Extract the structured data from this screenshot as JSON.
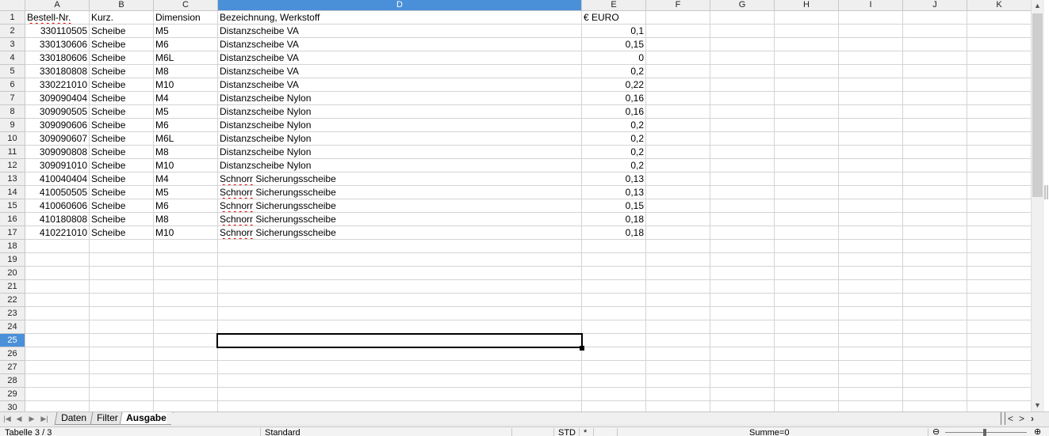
{
  "columns": [
    "A",
    "B",
    "C",
    "D",
    "E",
    "F",
    "G",
    "H",
    "I",
    "J",
    "K"
  ],
  "selected_column": "D",
  "selected_row": "25",
  "row_numbers": [
    "1",
    "2",
    "3",
    "4",
    "5",
    "6",
    "7",
    "8",
    "9",
    "10",
    "11",
    "12",
    "13",
    "14",
    "15",
    "16",
    "17",
    "18",
    "19",
    "20",
    "21",
    "22",
    "23",
    "24",
    "25",
    "26",
    "27",
    "28",
    "29",
    "30"
  ],
  "table": {
    "headers": [
      "Bestell-Nr.",
      "Kurz.",
      "Dimension",
      "Bezeichnung, Werkstoff",
      "€ EURO"
    ],
    "rows": [
      [
        "330110505",
        "Scheibe",
        "M5",
        "Distanzscheibe VA",
        "0,1"
      ],
      [
        "330130606",
        "Scheibe",
        "M6",
        "Distanzscheibe VA",
        "0,15"
      ],
      [
        "330180606",
        "Scheibe",
        "M6L",
        "Distanzscheibe VA",
        "0"
      ],
      [
        "330180808",
        "Scheibe",
        "M8",
        "Distanzscheibe VA",
        "0,2"
      ],
      [
        "330221010",
        "Scheibe",
        "M10",
        "Distanzscheibe VA",
        "0,22"
      ],
      [
        "309090404",
        "Scheibe",
        "M4",
        "Distanzscheibe Nylon",
        "0,16"
      ],
      [
        "309090505",
        "Scheibe",
        "M5",
        "Distanzscheibe Nylon",
        "0,16"
      ],
      [
        "309090606",
        "Scheibe",
        "M6",
        "Distanzscheibe Nylon",
        "0,2"
      ],
      [
        "309090607",
        "Scheibe",
        "M6L",
        "Distanzscheibe Nylon",
        "0,2"
      ],
      [
        "309090808",
        "Scheibe",
        "M8",
        "Distanzscheibe Nylon",
        "0,2"
      ],
      [
        "309091010",
        "Scheibe",
        "M10",
        "Distanzscheibe Nylon",
        "0,2"
      ],
      [
        "410040404",
        "Scheibe",
        "M4",
        "Schnorr Sicherungsscheibe",
        "0,13"
      ],
      [
        "410050505",
        "Scheibe",
        "M5",
        "Schnorr Sicherungsscheibe",
        "0,13"
      ],
      [
        "410060606",
        "Scheibe",
        "M6",
        "Schnorr Sicherungsscheibe",
        "0,15"
      ],
      [
        "410180808",
        "Scheibe",
        "M8",
        "Schnorr Sicherungsscheibe",
        "0,18"
      ],
      [
        "410221010",
        "Scheibe",
        "M10",
        "Schnorr Sicherungsscheibe",
        "0,18"
      ]
    ]
  },
  "sheet_tabs": [
    "Daten",
    "Filter",
    "Ausgabe"
  ],
  "active_tab": "Ausgabe",
  "status": {
    "sheet": "Tabelle 3 / 3",
    "page_style": "Standard",
    "mode": "STD",
    "modified": "*",
    "sum": "Summe=0"
  },
  "colors": {
    "header_bg": "#efefef",
    "selection_highlight": "#4a90d9",
    "spellcheck": "#e00000"
  },
  "icons": [
    "first-sheet-icon",
    "prev-sheet-icon",
    "next-sheet-icon",
    "last-sheet-icon",
    "scroll-up-icon",
    "scroll-down-icon",
    "scroll-left-icon",
    "scroll-right-icon",
    "zoom-out-icon",
    "zoom-in-icon"
  ]
}
